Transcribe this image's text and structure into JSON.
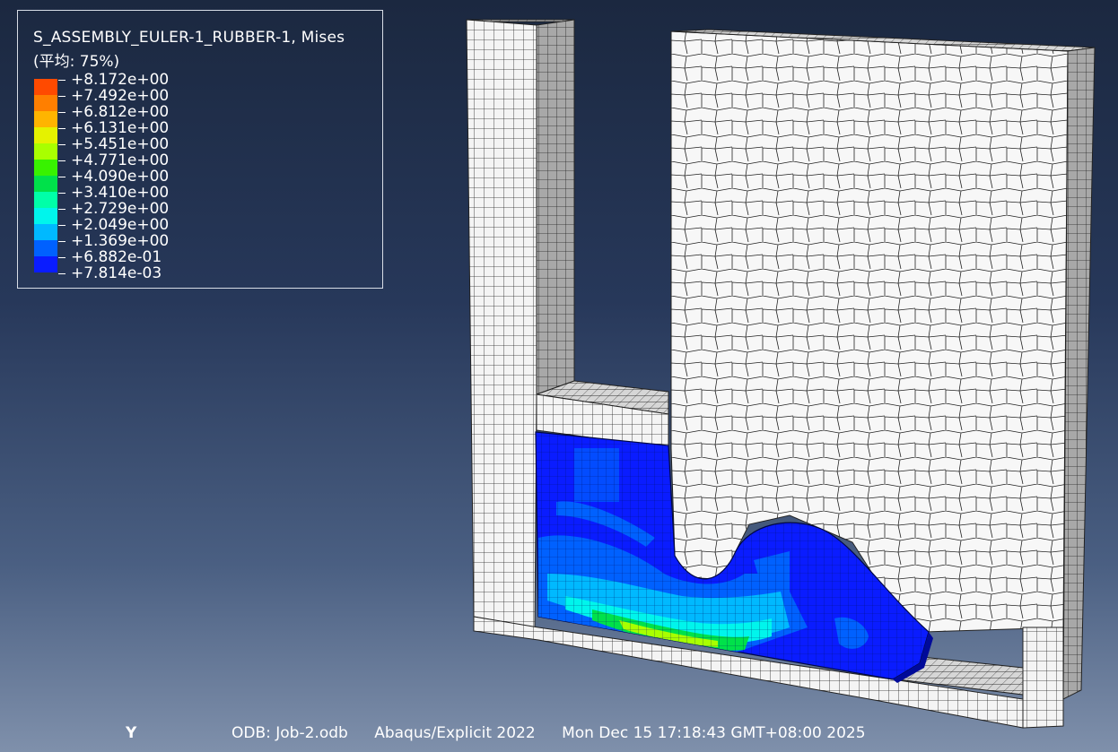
{
  "legend": {
    "title": "S_ASSEMBLY_EULER-1_RUBBER-1, Mises",
    "subtitle": "(平均: 75%)",
    "entries": [
      {
        "value": "+8.172e+00",
        "color": "#ff0000"
      },
      {
        "value": "+7.492e+00",
        "color": "#ff4a00"
      },
      {
        "value": "+6.812e+00",
        "color": "#ff7f00"
      },
      {
        "value": "+6.131e+00",
        "color": "#ffb400"
      },
      {
        "value": "+5.451e+00",
        "color": "#e5f200"
      },
      {
        "value": "+4.771e+00",
        "color": "#a9ff00"
      },
      {
        "value": "+4.090e+00",
        "color": "#38f200"
      },
      {
        "value": "+3.410e+00",
        "color": "#00e14a"
      },
      {
        "value": "+2.729e+00",
        "color": "#00ffa8"
      },
      {
        "value": "+2.049e+00",
        "color": "#00f5ec"
      },
      {
        "value": "+1.369e+00",
        "color": "#00b9ff"
      },
      {
        "value": "+6.882e-01",
        "color": "#0061ff"
      },
      {
        "value": "+7.814e-03",
        "color": "#0a1cff"
      }
    ]
  },
  "footer": {
    "axis_label": "Y",
    "odb": "ODB: Job-2.odb",
    "solver": "Abaqus/Explicit 2022",
    "timestamp": "Mon Dec 15 17:18:43 GMT+08:00 2025"
  }
}
